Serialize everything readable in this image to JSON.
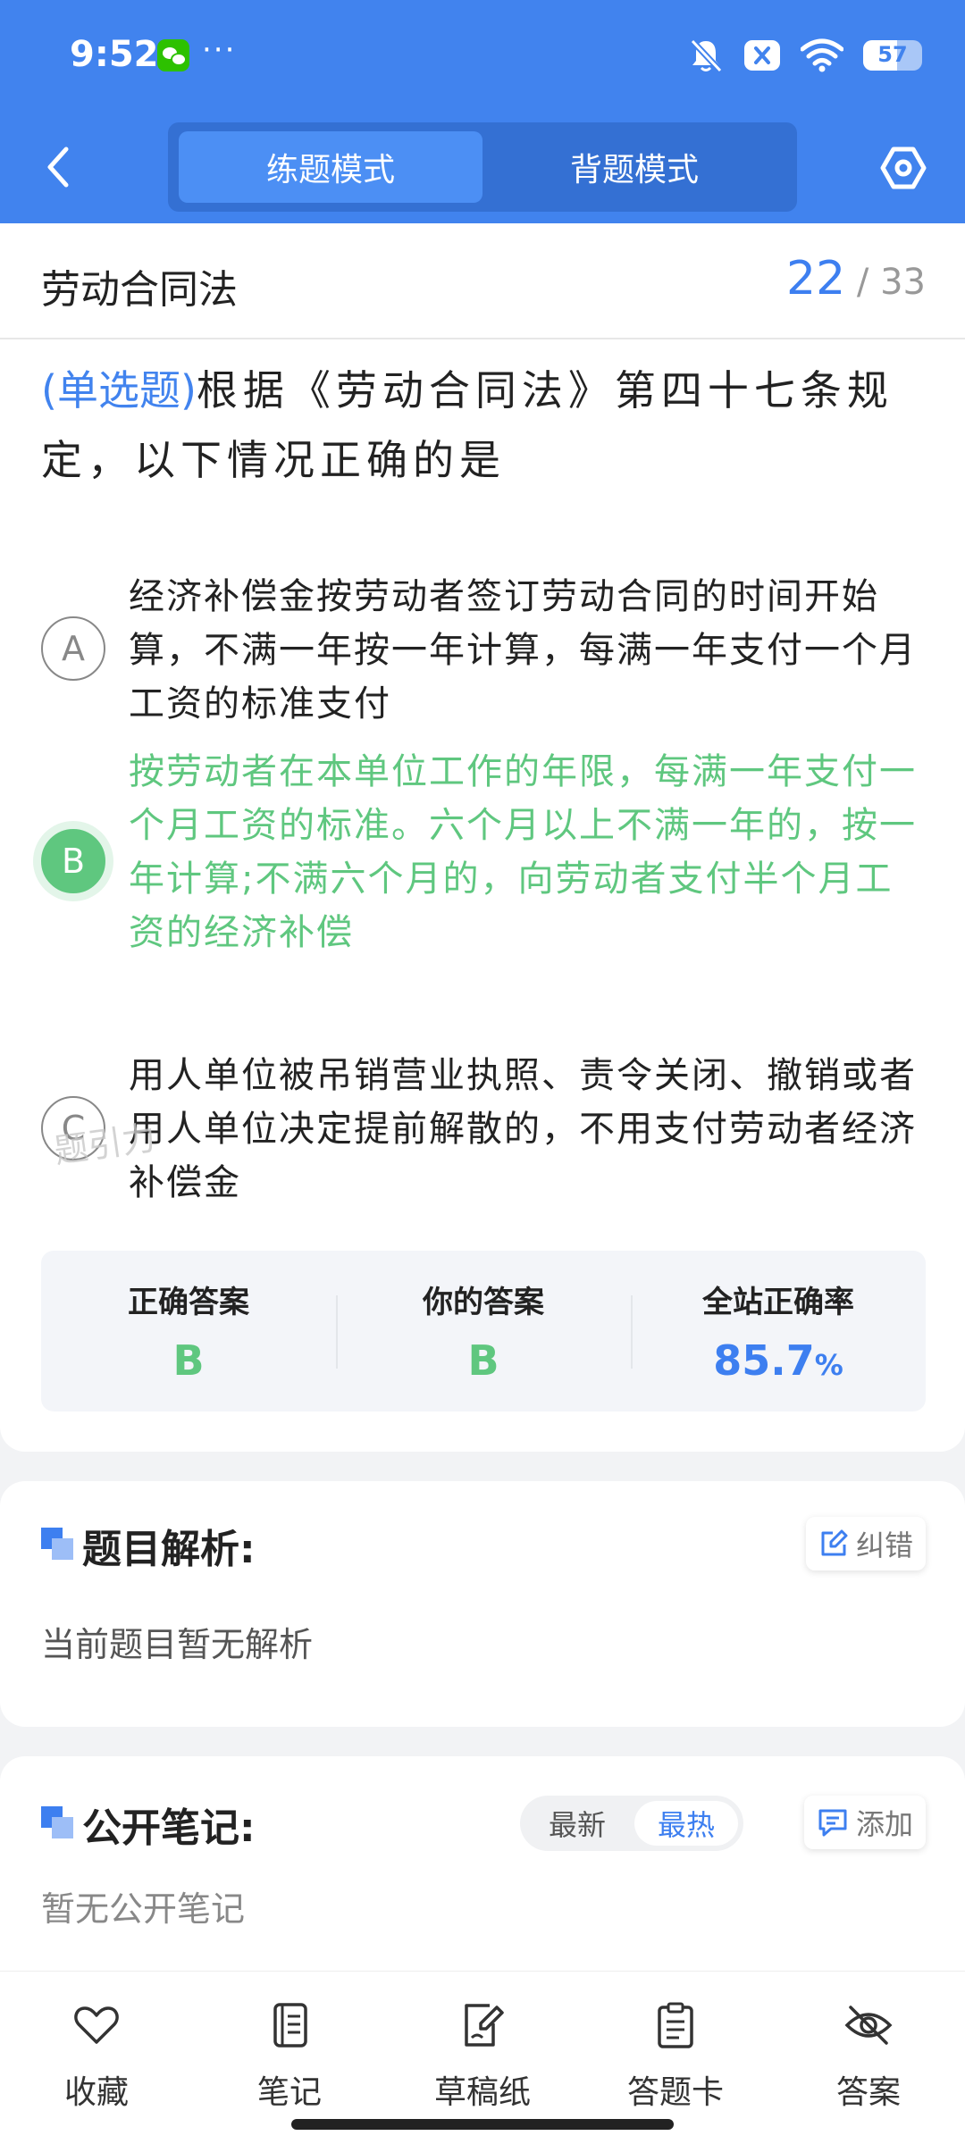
{
  "status_bar": {
    "time": "9:52",
    "more": "···",
    "battery_percent": "57",
    "battery_level": 0.57
  },
  "nav": {
    "modes": [
      "练题模式",
      "背题模式"
    ],
    "active_mode": "练题模式"
  },
  "chapter": {
    "title": "劳动合同法",
    "current": "22",
    "separator": "/",
    "total": "33"
  },
  "question": {
    "type": "(单选题)",
    "text": "根据《劳动合同法》第四十七条规定，以下情况正确的是"
  },
  "options": [
    {
      "letter": "A",
      "text": "经济补偿金按劳动者签订劳动合同的时间开始算，不满一年按一年计算，每满一年支付一个月工资的标准支付"
    },
    {
      "letter": "B",
      "text": "按劳动者在本单位工作的年限，每满一年支付一个月工资的标准。六个月以上不满一年的，按一年计算;不满六个月的，向劳动者支付半个月工资的经济补偿"
    },
    {
      "letter": "C",
      "text": "用人单位被吊销营业执照、责令关闭、撤销或者用人单位决定提前解散的，不用支付劳动者经济补偿金"
    }
  ],
  "watermark": "题引力",
  "stats": {
    "correct_label": "正确答案",
    "correct_value": "B",
    "yours_label": "你的答案",
    "yours_value": "B",
    "rate_label": "全站正确率",
    "rate_value": "85.7",
    "rate_unit": "%"
  },
  "analysis": {
    "title": "题目解析:",
    "body": "当前题目暂无解析",
    "report_label": "纠错"
  },
  "notes": {
    "title": "公开笔记:",
    "sort_latest": "最新",
    "sort_hot": "最热",
    "add_label": "添加",
    "empty": "暂无公开笔记"
  },
  "bottom_tabs": [
    {
      "label": "收藏",
      "icon": "heart-icon"
    },
    {
      "label": "笔记",
      "icon": "notebook-icon"
    },
    {
      "label": "草稿纸",
      "icon": "draft-icon"
    },
    {
      "label": "答题卡",
      "icon": "answer-sheet-icon"
    },
    {
      "label": "答案",
      "icon": "eye-off-icon"
    }
  ],
  "colors": {
    "primary": "#4183ee",
    "correct": "#5fc77f",
    "background": "#f2f3f5"
  }
}
